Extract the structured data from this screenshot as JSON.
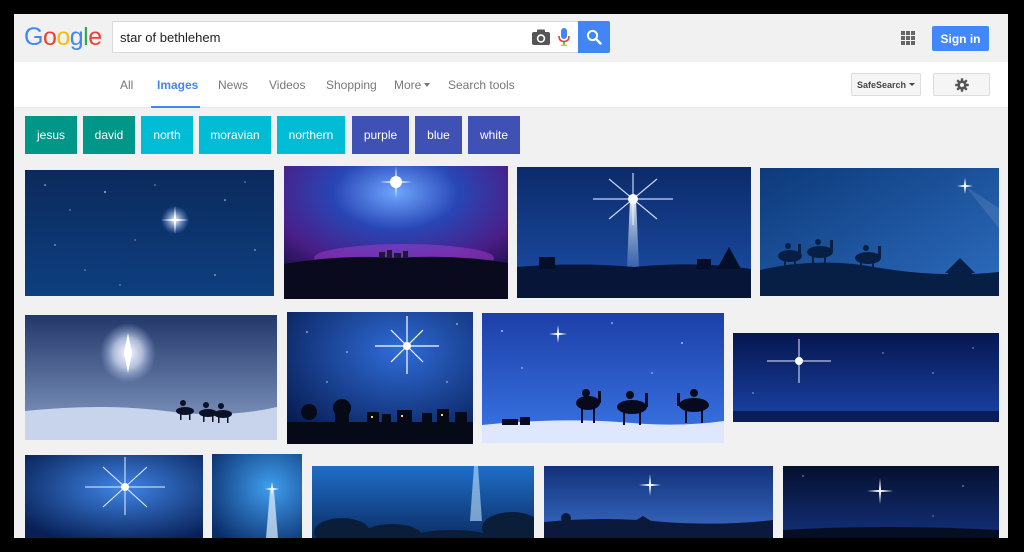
{
  "search": {
    "query": "star of bethlehem"
  },
  "logo": {
    "letters": [
      "G",
      "o",
      "o",
      "g",
      "l",
      "e"
    ],
    "colors": [
      "#4285f4",
      "#ea4335",
      "#fbbc05",
      "#4285f4",
      "#34a853",
      "#ea4335"
    ]
  },
  "header": {
    "signin_label": "Sign in",
    "apps_icon": "apps-grid-icon"
  },
  "nav": {
    "tabs": [
      "All",
      "Images",
      "News",
      "Videos",
      "Shopping",
      "More",
      "Search tools"
    ],
    "active_tab": "Images",
    "safesearch_label": "SafeSearch"
  },
  "chips": [
    {
      "label": "jesus",
      "color": "#009688"
    },
    {
      "label": "david",
      "color": "#009688"
    },
    {
      "label": "north",
      "color": "#00bcd4"
    },
    {
      "label": "moravian",
      "color": "#00bcd4"
    },
    {
      "label": "northern",
      "color": "#00bcd4"
    },
    {
      "label": "purple",
      "color": "#3f51b5"
    },
    {
      "label": "blue",
      "color": "#3f51b5"
    },
    {
      "label": "white",
      "color": "#3f51b5"
    }
  ],
  "colors": {
    "accent": "#4285f4",
    "signin": "#4387fd"
  }
}
